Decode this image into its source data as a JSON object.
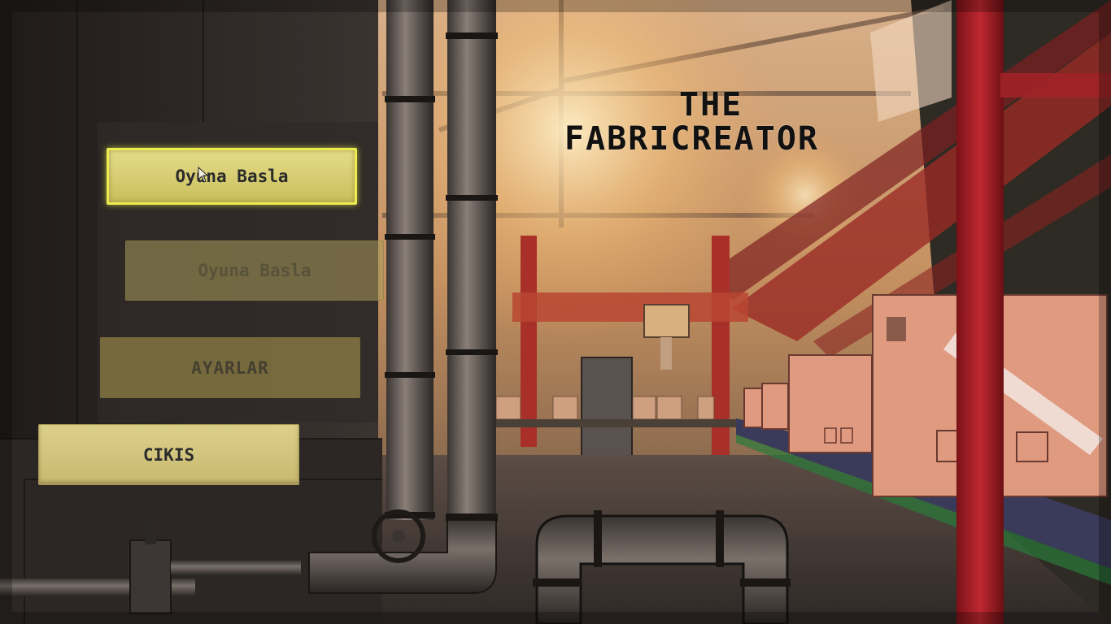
{
  "game": {
    "title_line1": "THE",
    "title_line2": "FABRICREATOR"
  },
  "menu": {
    "start_label": "Oyuna Basla",
    "start_ghost_label": "Oyuna Basla",
    "settings_label": "AYARLAR",
    "exit_label": "CIKIS"
  },
  "colors": {
    "button_highlight": "#ecec50",
    "button_fill": "#d8cc78",
    "pillar_red": "#b5232a",
    "box_pink": "#e8937a"
  }
}
